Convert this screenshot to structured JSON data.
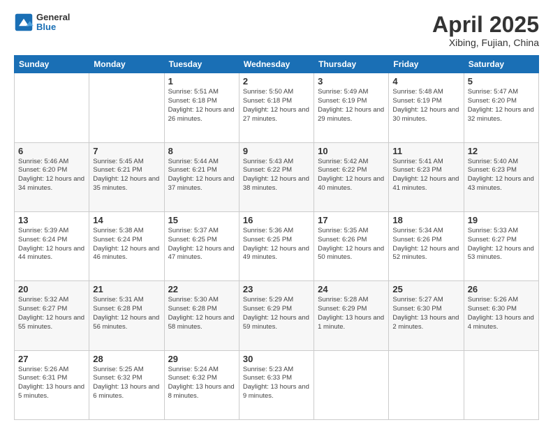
{
  "header": {
    "logo_line1": "General",
    "logo_line2": "Blue",
    "title": "April 2025",
    "subtitle": "Xibing, Fujian, China"
  },
  "days_of_week": [
    "Sunday",
    "Monday",
    "Tuesday",
    "Wednesday",
    "Thursday",
    "Friday",
    "Saturday"
  ],
  "weeks": [
    [
      {
        "day": "",
        "info": ""
      },
      {
        "day": "",
        "info": ""
      },
      {
        "day": "1",
        "info": "Sunrise: 5:51 AM\nSunset: 6:18 PM\nDaylight: 12 hours and 26 minutes."
      },
      {
        "day": "2",
        "info": "Sunrise: 5:50 AM\nSunset: 6:18 PM\nDaylight: 12 hours and 27 minutes."
      },
      {
        "day": "3",
        "info": "Sunrise: 5:49 AM\nSunset: 6:19 PM\nDaylight: 12 hours and 29 minutes."
      },
      {
        "day": "4",
        "info": "Sunrise: 5:48 AM\nSunset: 6:19 PM\nDaylight: 12 hours and 30 minutes."
      },
      {
        "day": "5",
        "info": "Sunrise: 5:47 AM\nSunset: 6:20 PM\nDaylight: 12 hours and 32 minutes."
      }
    ],
    [
      {
        "day": "6",
        "info": "Sunrise: 5:46 AM\nSunset: 6:20 PM\nDaylight: 12 hours and 34 minutes."
      },
      {
        "day": "7",
        "info": "Sunrise: 5:45 AM\nSunset: 6:21 PM\nDaylight: 12 hours and 35 minutes."
      },
      {
        "day": "8",
        "info": "Sunrise: 5:44 AM\nSunset: 6:21 PM\nDaylight: 12 hours and 37 minutes."
      },
      {
        "day": "9",
        "info": "Sunrise: 5:43 AM\nSunset: 6:22 PM\nDaylight: 12 hours and 38 minutes."
      },
      {
        "day": "10",
        "info": "Sunrise: 5:42 AM\nSunset: 6:22 PM\nDaylight: 12 hours and 40 minutes."
      },
      {
        "day": "11",
        "info": "Sunrise: 5:41 AM\nSunset: 6:23 PM\nDaylight: 12 hours and 41 minutes."
      },
      {
        "day": "12",
        "info": "Sunrise: 5:40 AM\nSunset: 6:23 PM\nDaylight: 12 hours and 43 minutes."
      }
    ],
    [
      {
        "day": "13",
        "info": "Sunrise: 5:39 AM\nSunset: 6:24 PM\nDaylight: 12 hours and 44 minutes."
      },
      {
        "day": "14",
        "info": "Sunrise: 5:38 AM\nSunset: 6:24 PM\nDaylight: 12 hours and 46 minutes."
      },
      {
        "day": "15",
        "info": "Sunrise: 5:37 AM\nSunset: 6:25 PM\nDaylight: 12 hours and 47 minutes."
      },
      {
        "day": "16",
        "info": "Sunrise: 5:36 AM\nSunset: 6:25 PM\nDaylight: 12 hours and 49 minutes."
      },
      {
        "day": "17",
        "info": "Sunrise: 5:35 AM\nSunset: 6:26 PM\nDaylight: 12 hours and 50 minutes."
      },
      {
        "day": "18",
        "info": "Sunrise: 5:34 AM\nSunset: 6:26 PM\nDaylight: 12 hours and 52 minutes."
      },
      {
        "day": "19",
        "info": "Sunrise: 5:33 AM\nSunset: 6:27 PM\nDaylight: 12 hours and 53 minutes."
      }
    ],
    [
      {
        "day": "20",
        "info": "Sunrise: 5:32 AM\nSunset: 6:27 PM\nDaylight: 12 hours and 55 minutes."
      },
      {
        "day": "21",
        "info": "Sunrise: 5:31 AM\nSunset: 6:28 PM\nDaylight: 12 hours and 56 minutes."
      },
      {
        "day": "22",
        "info": "Sunrise: 5:30 AM\nSunset: 6:28 PM\nDaylight: 12 hours and 58 minutes."
      },
      {
        "day": "23",
        "info": "Sunrise: 5:29 AM\nSunset: 6:29 PM\nDaylight: 12 hours and 59 minutes."
      },
      {
        "day": "24",
        "info": "Sunrise: 5:28 AM\nSunset: 6:29 PM\nDaylight: 13 hours and 1 minute."
      },
      {
        "day": "25",
        "info": "Sunrise: 5:27 AM\nSunset: 6:30 PM\nDaylight: 13 hours and 2 minutes."
      },
      {
        "day": "26",
        "info": "Sunrise: 5:26 AM\nSunset: 6:30 PM\nDaylight: 13 hours and 4 minutes."
      }
    ],
    [
      {
        "day": "27",
        "info": "Sunrise: 5:26 AM\nSunset: 6:31 PM\nDaylight: 13 hours and 5 minutes."
      },
      {
        "day": "28",
        "info": "Sunrise: 5:25 AM\nSunset: 6:32 PM\nDaylight: 13 hours and 6 minutes."
      },
      {
        "day": "29",
        "info": "Sunrise: 5:24 AM\nSunset: 6:32 PM\nDaylight: 13 hours and 8 minutes."
      },
      {
        "day": "30",
        "info": "Sunrise: 5:23 AM\nSunset: 6:33 PM\nDaylight: 13 hours and 9 minutes."
      },
      {
        "day": "",
        "info": ""
      },
      {
        "day": "",
        "info": ""
      },
      {
        "day": "",
        "info": ""
      }
    ]
  ]
}
